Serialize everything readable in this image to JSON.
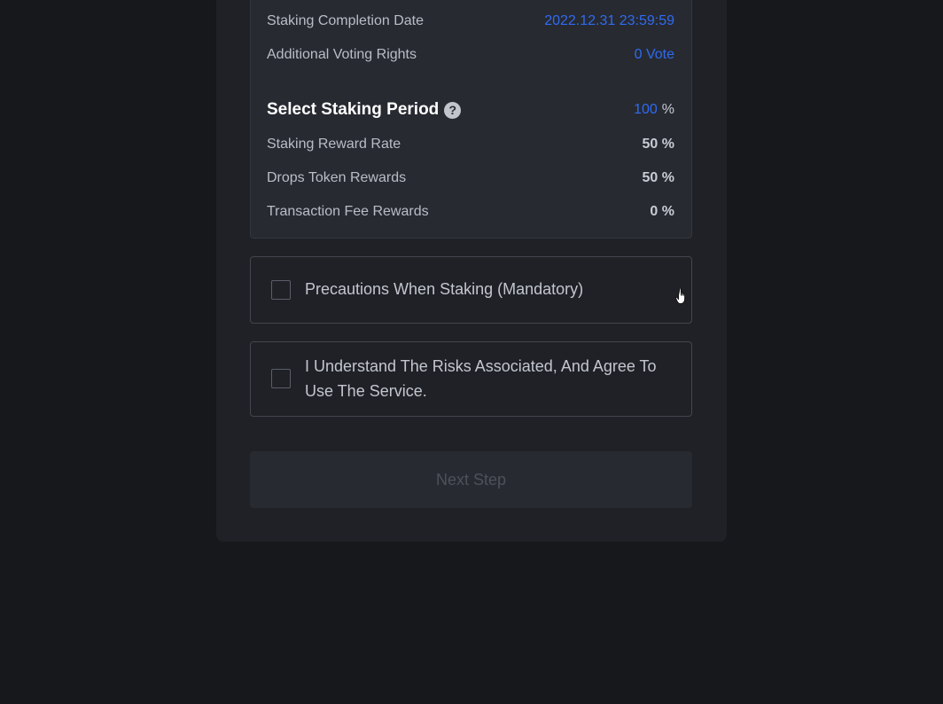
{
  "summary": {
    "completion_date_label": "Staking Completion Date",
    "completion_date_value": "2022.12.31 23:59:59",
    "voting_rights_label": "Additional Voting Rights",
    "voting_rights_value": "0 Vote",
    "period_title": "Select Staking Period",
    "period_help_icon": "?",
    "period_value": "100",
    "period_unit": "%",
    "reward_rate_label": "Staking Reward Rate",
    "reward_rate_value": "50 %",
    "drops_label": "Drops Token Rewards",
    "drops_value": "50 %",
    "fee_label": "Transaction Fee Rewards",
    "fee_value": "0 %"
  },
  "agreements": {
    "precautions_label": "Precautions When Staking (Mandatory)",
    "precautions_checked": false,
    "risks_label": "I Understand The Risks Associated, And Agree To Use The Service.",
    "risks_checked": false
  },
  "actions": {
    "next_label": "Next Step",
    "next_enabled": false
  },
  "colors": {
    "accent_blue": "#2f6bf0",
    "page_bg": "#17181c",
    "card_bg": "#1f2126",
    "panel_bg": "#272a31"
  },
  "icons": {
    "help": "help-icon",
    "cursor": "hand-cursor-icon"
  }
}
